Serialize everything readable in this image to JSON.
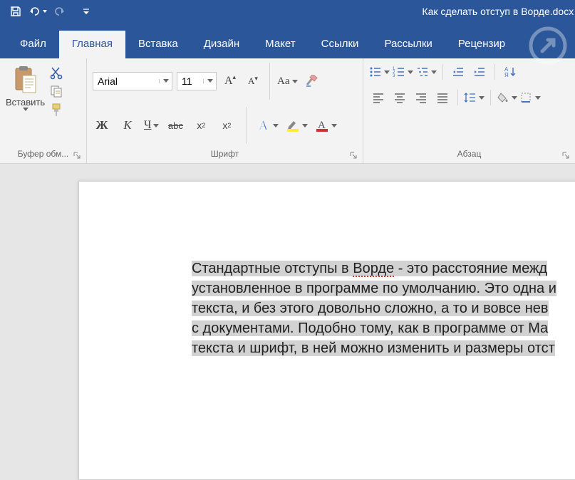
{
  "titlebar": {
    "doc_title": "Как сделать отступ в Ворде.docx - V"
  },
  "tabs": {
    "file": "Файл",
    "home": "Главная",
    "insert": "Вставка",
    "design": "Дизайн",
    "layout": "Макет",
    "references": "Ссылки",
    "mailings": "Рассылки",
    "review": "Рецензир"
  },
  "ribbon": {
    "clipboard": {
      "paste": "Вставить",
      "group_label": "Буфер обм..."
    },
    "font": {
      "name": "Arial",
      "size": "11",
      "group_label": "Шрифт",
      "bold": "Ж",
      "italic": "К",
      "underline": "Ч",
      "strike": "abc",
      "sub": "x",
      "sup": "x",
      "aa": "Aa"
    },
    "paragraph": {
      "group_label": "Абзац"
    }
  },
  "document": {
    "line1a": "Стандартные отступы в ",
    "line1_word": "Ворде",
    "line1b": " - это расстояние межд",
    "line2": "установленное в программе по умолчанию. Это одна и",
    "line3": "текста, и без этого довольно сложно, а то и вовсе нев",
    "line4": "с документами. Подобно тому, как в программе от Ma",
    "line5": "текста и шрифт, в ней можно изменить и размеры отст"
  }
}
